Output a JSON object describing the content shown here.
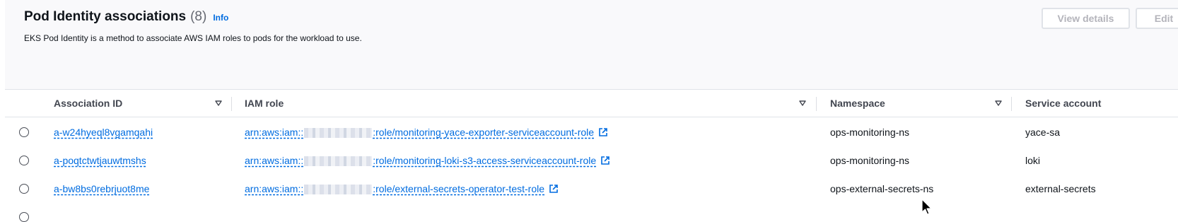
{
  "header": {
    "title": "Pod Identity associations",
    "count": "(8)",
    "info_label": "Info",
    "description": "EKS Pod Identity is a method to associate AWS IAM roles to pods for the workload to use.",
    "buttons": {
      "view_details": "View details",
      "edit": "Edit"
    }
  },
  "table": {
    "columns": {
      "association_id": "Association ID",
      "iam_role": "IAM role",
      "namespace": "Namespace",
      "service_account": "Service account"
    },
    "rows": [
      {
        "association_id": "a-w24hyeql8vgamqahi",
        "iam_role_prefix": "arn:aws:iam::",
        "iam_role_suffix": ":role/monitoring-yace-exporter-serviceaccount-role",
        "namespace": "ops-monitoring-ns",
        "service_account": "yace-sa"
      },
      {
        "association_id": "a-poqtctwtjauwtmshs",
        "iam_role_prefix": "arn:aws:iam::",
        "iam_role_suffix": ":role/monitoring-loki-s3-access-serviceaccount-role",
        "namespace": "ops-monitoring-ns",
        "service_account": "loki"
      },
      {
        "association_id": "a-bw8bs0rebrjuot8me",
        "iam_role_prefix": "arn:aws:iam::",
        "iam_role_suffix": ":role/external-secrets-operator-test-role",
        "namespace": "ops-external-secrets-ns",
        "service_account": "external-secrets"
      }
    ]
  },
  "icons": {
    "sort": "caret-down-icon",
    "external_link": "external-link-icon",
    "cursor": "mouse-pointer-icon"
  },
  "colors": {
    "link": "#006ce0",
    "header_bg": "#f9f9fb",
    "disabled_text": "#b4b4bb",
    "border": "#e0e3e8"
  }
}
